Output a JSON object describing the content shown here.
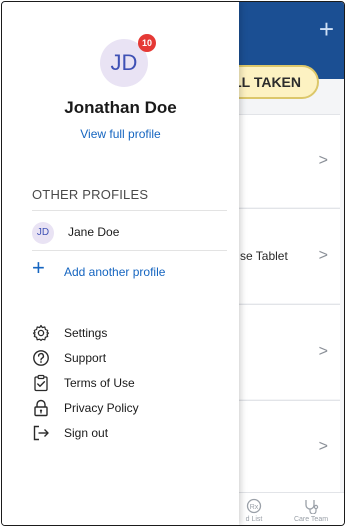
{
  "background": {
    "header_plus": "+",
    "taken_pill_label": "LL TAKEN",
    "cards": [
      {
        "text": "",
        "chevron": ">"
      },
      {
        "text": "se Tablet",
        "chevron": ">"
      },
      {
        "text": "",
        "chevron": ">"
      },
      {
        "text": "",
        "chevron": ">"
      }
    ],
    "bottom_nav": [
      {
        "label": "d List",
        "icon": "rx-icon"
      },
      {
        "label": "Care Team",
        "icon": "stethoscope-icon"
      }
    ]
  },
  "drawer": {
    "avatar_initials": "JD",
    "notification_count": "10",
    "user_name": "Jonathan Doe",
    "view_profile_label": "View full profile",
    "other_profiles_title": "OTHER PROFILES",
    "other_profiles": [
      {
        "initials": "JD",
        "name": "Jane Doe"
      }
    ],
    "add_profile_label": "Add another profile",
    "menu": [
      {
        "label": "Settings",
        "icon": "gear-icon"
      },
      {
        "label": "Support",
        "icon": "help-icon"
      },
      {
        "label": "Terms of Use",
        "icon": "clipboard-check-icon"
      },
      {
        "label": "Privacy Policy",
        "icon": "lock-icon"
      },
      {
        "label": "Sign out",
        "icon": "sign-out-icon"
      }
    ]
  },
  "colors": {
    "header": "#1b4f93",
    "accent": "#1565c0",
    "badge": "#e53935",
    "avatar_bg": "#e9e3f4"
  }
}
